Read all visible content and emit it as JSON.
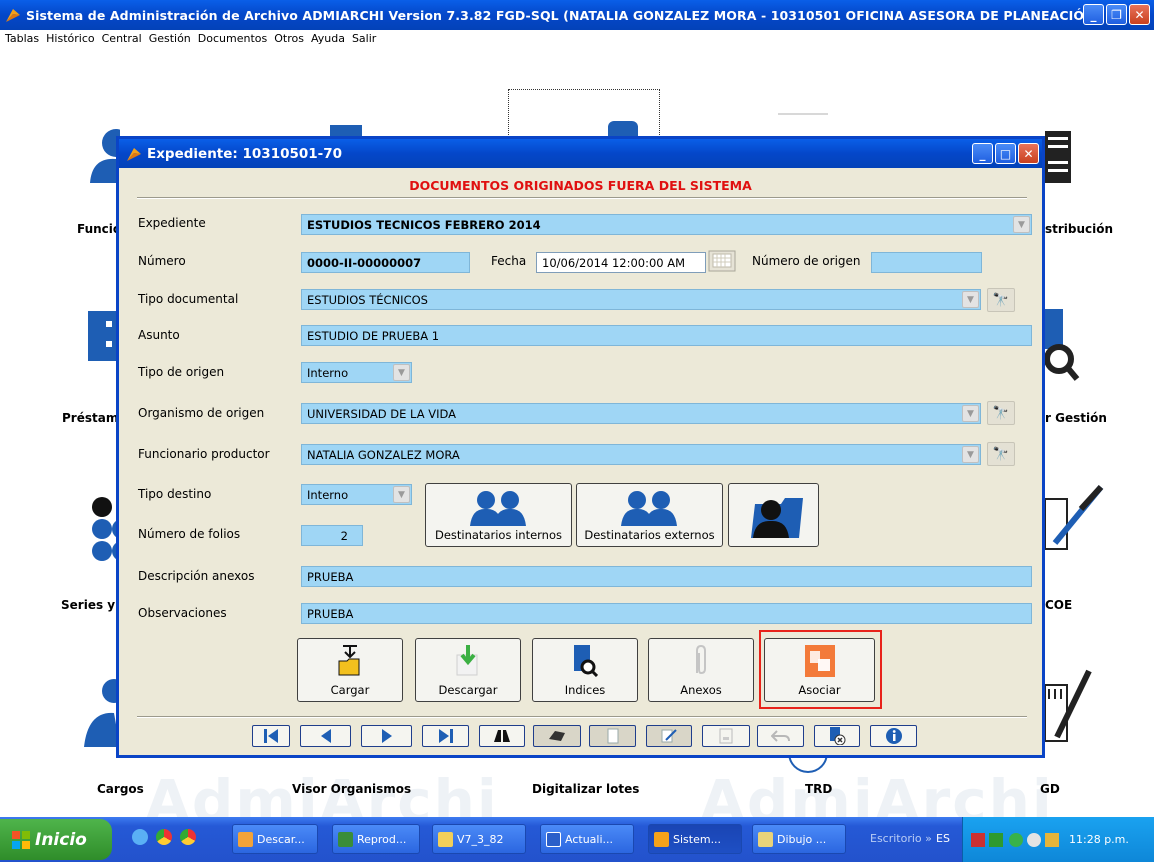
{
  "window": {
    "title": "Sistema de Administración de Archivo ADMIARCHI Version 7.3.82 FGD-SQL (NATALIA GONZALEZ MORA - 10310501 OFICINA ASESORA DE PLANEACIÓN)"
  },
  "menu": [
    "Tablas",
    "Histórico",
    "Central",
    "Gestión",
    "Documentos",
    "Otros",
    "Ayuda",
    "Salir"
  ],
  "desktop": {
    "tiles": {
      "funcio": "Funcio",
      "distribucion": "stribución",
      "prestam": "Préstam",
      "gestion": "r Gestión",
      "series": "Series y S",
      "coe": "COE",
      "cargos": "Cargos",
      "visor": "Visor Organismos",
      "digitalizar": "Digitalizar lotes",
      "trd": "TRD",
      "gd": "GD"
    },
    "watermark": "AdmiArchi"
  },
  "dialog": {
    "title": "Expediente: 10310501-70",
    "heading": "DOCUMENTOS ORIGINADOS FUERA DEL SISTEMA",
    "labels": {
      "expediente": "Expediente",
      "numero": "Número",
      "fecha": "Fecha",
      "numero_origen": "Número de origen",
      "tipo_documental": "Tipo documental",
      "asunto": "Asunto",
      "tipo_origen": "Tipo de origen",
      "organismo_origen": "Organismo de origen",
      "funcionario_productor": "Funcionario productor",
      "tipo_destino": "Tipo destino",
      "numero_folios": "Número de folios",
      "descripcion_anexos": "Descripción anexos",
      "observaciones": "Observaciones"
    },
    "values": {
      "expediente": "ESTUDIOS TECNICOS FEBRERO 2014",
      "numero": "0000-II-00000007",
      "fecha": "10/06/2014 12:00:00 AM",
      "numero_origen": "",
      "tipo_documental": "ESTUDIOS TÉCNICOS",
      "asunto": "ESTUDIO DE PRUEBA 1",
      "tipo_origen": "Interno",
      "organismo_origen": "UNIVERSIDAD DE LA VIDA",
      "funcionario_productor": "NATALIA GONZALEZ MORA",
      "tipo_destino": "Interno",
      "numero_folios": "2",
      "descripcion_anexos": "PRUEBA",
      "observaciones": "PRUEBA"
    },
    "dest_buttons": {
      "internos": "Destinatarios internos",
      "externos": "Destinatarios externos"
    },
    "actions": {
      "cargar": "Cargar",
      "descargar": "Descargar",
      "indices": "Indices",
      "anexos": "Anexos",
      "asociar": "Asociar"
    },
    "highlight_color": "#e8221a"
  },
  "taskbar": {
    "start": "Inicio",
    "tasks": [
      "Descar...",
      "Reprod...",
      "V7_3_82",
      "Actuali...",
      "Sistem...",
      "Dibujo ...",
      "Escritorio"
    ],
    "lang": "ES",
    "clock": "11:28 p.m."
  },
  "colors": {
    "titlebar": "#0447c9",
    "field_bg": "#9fd6f5",
    "heading": "#e01010",
    "dialog_bg": "#ece9d8"
  }
}
